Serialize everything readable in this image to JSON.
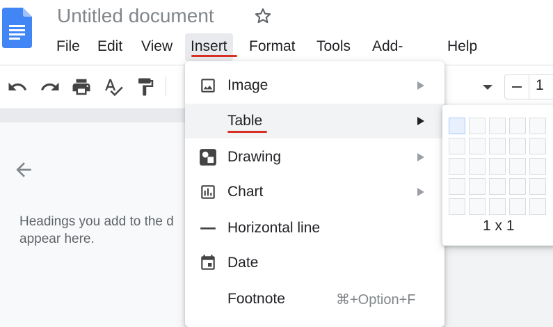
{
  "header": {
    "title": "Untitled document",
    "logo_icon": "google-docs-icon",
    "star_icon": "star-outline-icon"
  },
  "menubar": {
    "items": [
      {
        "label": "File"
      },
      {
        "label": "Edit"
      },
      {
        "label": "View"
      },
      {
        "label": "Insert",
        "active": true
      },
      {
        "label": "Format"
      },
      {
        "label": "Tools"
      },
      {
        "label": "Add-ons"
      },
      {
        "label": "Help"
      }
    ]
  },
  "toolbar": {
    "icons": [
      "undo-icon",
      "redo-icon",
      "print-icon",
      "spellcheck-icon",
      "paint-format-icon"
    ],
    "font_size": "1"
  },
  "outline": {
    "placeholder": "Headings you add to the d\nappear here."
  },
  "insert_menu": {
    "items": [
      {
        "label": "Image",
        "icon": "image-icon",
        "submenu": true
      },
      {
        "label": "Table",
        "icon": "",
        "submenu": true,
        "hover": true
      },
      {
        "label": "Drawing",
        "icon": "drawing-icon",
        "submenu": true
      },
      {
        "label": "Chart",
        "icon": "chart-icon",
        "submenu": true
      },
      {
        "label": "Horizontal line",
        "icon": "horizontal-line-icon",
        "submenu": false
      },
      {
        "label": "Date",
        "icon": "calendar-icon",
        "submenu": false
      },
      {
        "label": "Footnote",
        "icon": "",
        "submenu": false,
        "shortcut": "⌘+Option+F"
      }
    ]
  },
  "table_picker": {
    "selection_label": "1 x 1",
    "rows": 5,
    "cols": 5,
    "selected_rows": 1,
    "selected_cols": 1
  },
  "colors": {
    "accent_underline": "#d93025",
    "docs_blue": "#4285f4",
    "selected_cell": "#e8f0fe"
  }
}
